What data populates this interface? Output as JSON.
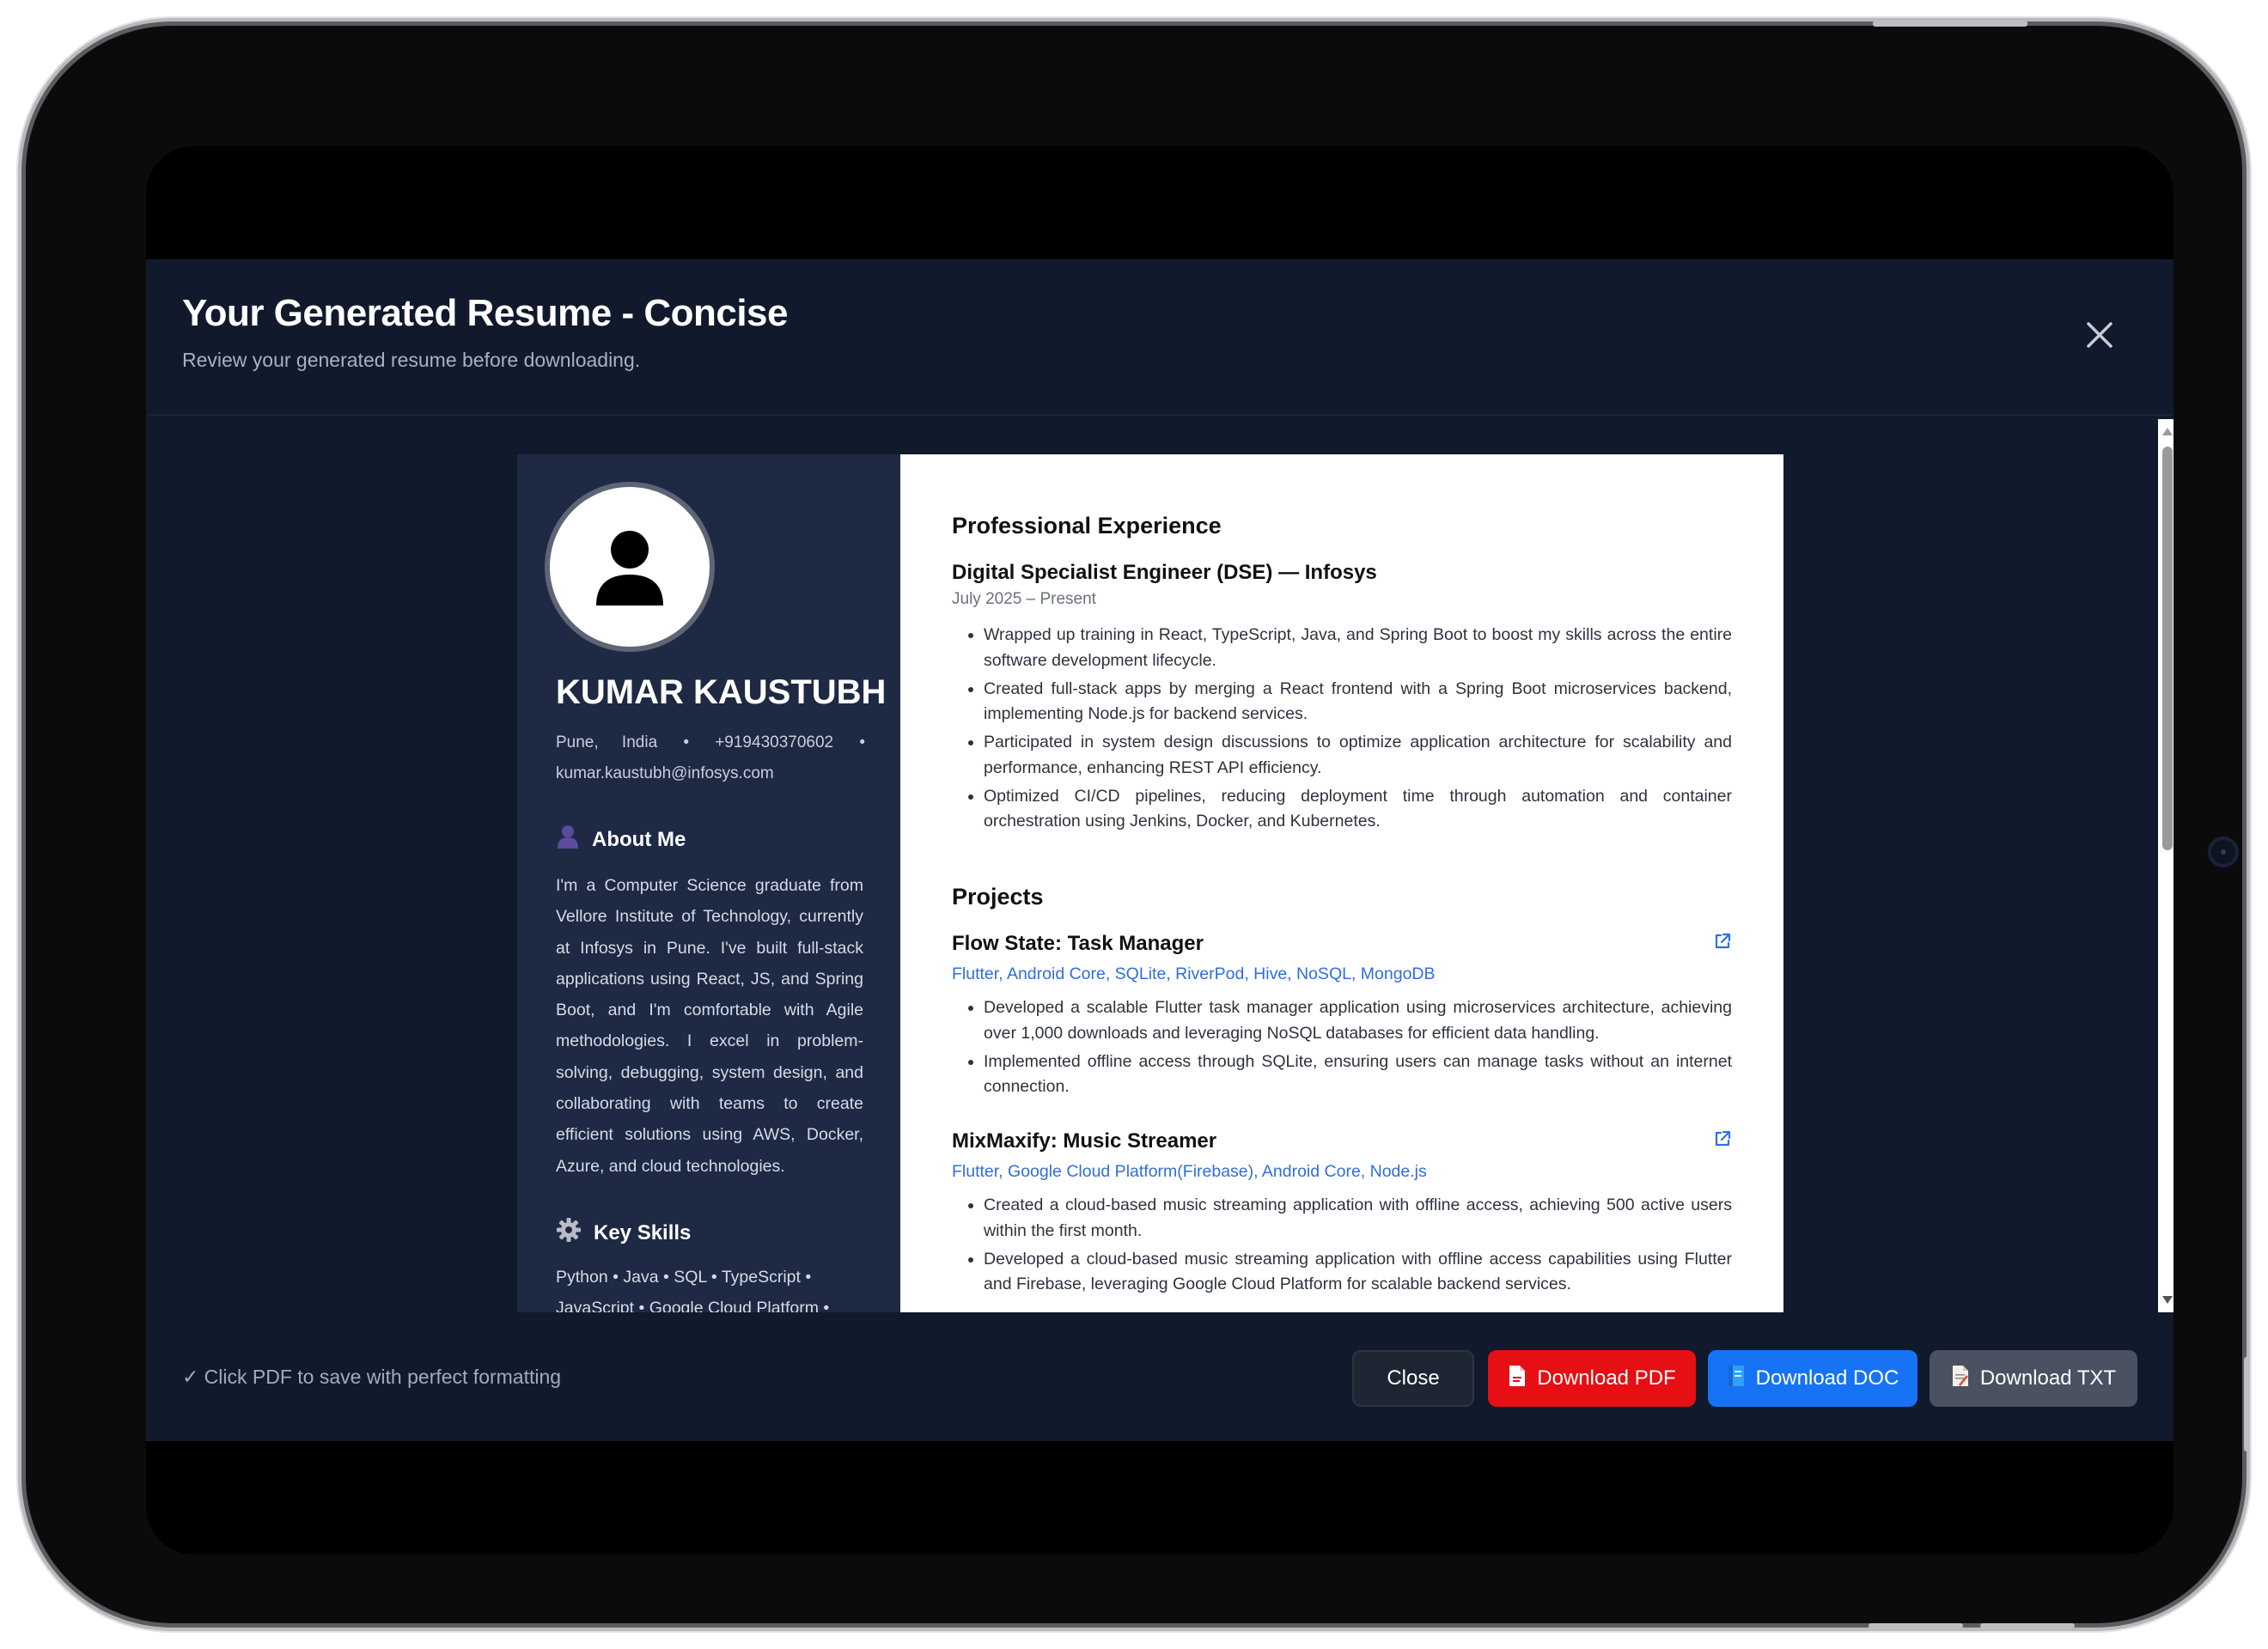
{
  "modal": {
    "title": "Your Generated Resume - Concise",
    "subtitle": "Review your generated resume before downloading."
  },
  "resume": {
    "name": "KUMAR KAUSTUBH",
    "contact": {
      "location": "Pune, India",
      "separator": "•",
      "phone": "+919430370602",
      "email": "kumar.kaustubh@infosys.com"
    },
    "about": {
      "heading": "About Me",
      "text": "I'm a Computer Science graduate from Vellore Institute of Technology, currently at Infosys in Pune. I've built full-stack applications using React, JS, and Spring Boot, and I'm comfortable with Agile methodologies. I excel in problem-solving, debugging, system design, and collaborating with teams to create efficient solutions using AWS, Docker, Azure, and cloud technologies."
    },
    "skills": {
      "heading": "Key Skills",
      "text": "Python • Java • SQL • TypeScript • JavaScript • Google Cloud Platform •"
    },
    "experience": {
      "heading": "Professional Experience",
      "jobs": [
        {
          "title": "Digital Specialist Engineer (DSE) — Infosys",
          "date": "July 2025 – Present",
          "bullets": [
            "Wrapped up training in React, TypeScript, Java, and Spring Boot to boost my skills across the entire software development lifecycle.",
            "Created full-stack apps by merging a React frontend with a Spring Boot microservices backend, implementing Node.js for backend services.",
            "Participated in system design discussions to optimize application architecture for scalability and performance, enhancing REST API efficiency.",
            "Optimized CI/CD pipelines, reducing deployment time through automation and container orchestration using Jenkins, Docker, and Kubernetes."
          ]
        }
      ]
    },
    "projects": {
      "heading": "Projects",
      "items": [
        {
          "title": "Flow State: Task Manager",
          "tech": "Flutter, Android Core, SQLite, RiverPod, Hive, NoSQL, MongoDB",
          "bullets": [
            "Developed a scalable Flutter task manager application using microservices architecture, achieving over 1,000 downloads and leveraging NoSQL databases for efficient data handling.",
            "Implemented offline access through SQLite, ensuring users can manage tasks without an internet connection."
          ]
        },
        {
          "title": "MixMaxify: Music Streamer",
          "tech": "Flutter, Google Cloud Platform(Firebase), Android Core, Node.js",
          "bullets": [
            "Created a cloud-based music streaming application with offline access, achieving 500 active users within the first month.",
            "Developed a cloud-based music streaming application with offline access capabilities using Flutter and Firebase, leveraging Google Cloud Platform for scalable backend services."
          ]
        }
      ]
    }
  },
  "footer": {
    "note": "✓ Click PDF to save with perfect formatting",
    "buttons": {
      "close": "Close",
      "pdf": "Download PDF",
      "doc": "Download DOC",
      "txt": "Download TXT"
    }
  },
  "colors": {
    "modal_bg": "#111a2c",
    "sidebar_bg": "#1e2944",
    "pdf_red": "#e60f14",
    "doc_blue": "#1673f5",
    "txt_gray": "#4a5160",
    "link_blue": "#2f6ee0"
  },
  "icons": {
    "close": "close-icon",
    "avatar": "user-avatar-icon",
    "about": "user-icon",
    "skills": "gear-icon",
    "external": "external-link-icon",
    "pdf": "pdf-file-icon",
    "doc": "doc-file-icon",
    "txt": "txt-file-icon"
  }
}
